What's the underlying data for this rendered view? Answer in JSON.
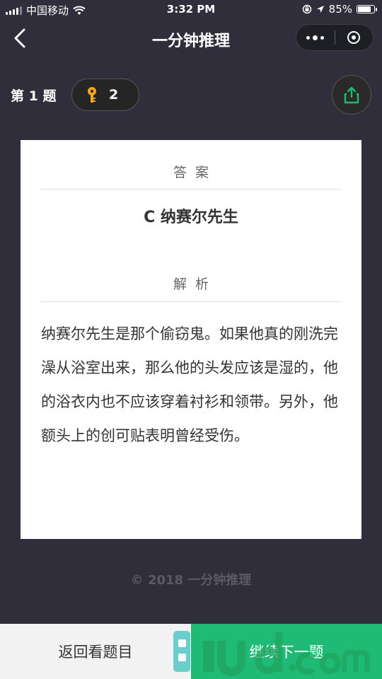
{
  "status_bar": {
    "carrier": "中国移动",
    "time": "3:32 PM",
    "battery_percent": "85%",
    "battery_level": 0.85
  },
  "nav": {
    "title": "一分钟推理",
    "back_icon": "chevron-left-icon",
    "more_icon": "more-dots-icon",
    "close_icon": "target-close-icon"
  },
  "question": {
    "label": "第 1 题",
    "key_count": "2",
    "key_icon": "key-icon",
    "key_color": "#f5a623",
    "share_icon": "share-icon",
    "share_color": "#1fbb76"
  },
  "card": {
    "answer_heading": "答案",
    "answer": "C 纳赛尔先生",
    "analysis_heading": "解析",
    "analysis": "纳赛尔先生是那个偷窃鬼。如果他真的刚洗完澡从浴室出来，那么他的头发应该是湿的，他的浴衣内也不应该穿着衬衫和领带。另外，他额头上的创可贴表明曾经受伤。"
  },
  "footer": {
    "copyright": "© 2018 一分钟推理"
  },
  "bottom": {
    "review_label": "返回看题目",
    "next_label": "继续下一题",
    "accent_color": "#1fbb76"
  }
}
